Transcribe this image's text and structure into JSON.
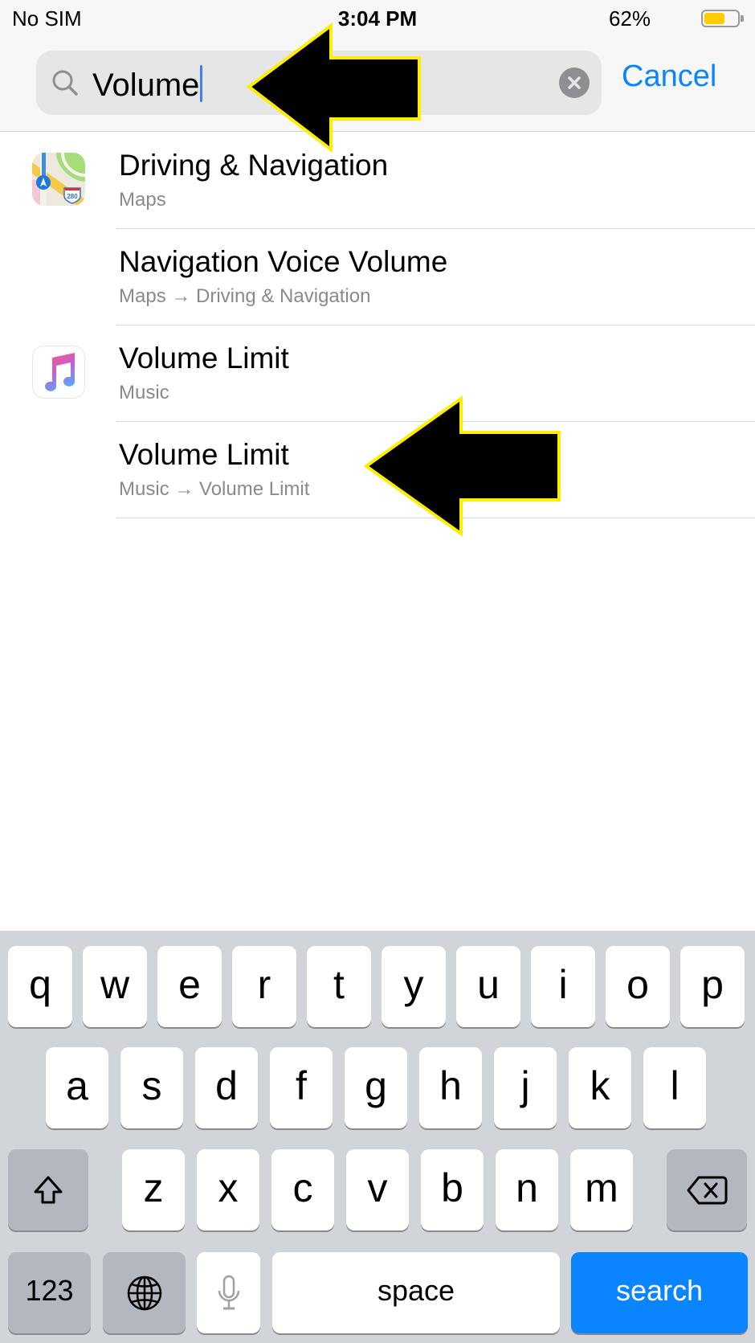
{
  "status_bar": {
    "carrier": "No SIM",
    "time": "3:04 PM",
    "battery_percent_label": "62%",
    "battery_level": 0.62,
    "battery_color": "#ffcc00"
  },
  "search": {
    "icon": "search-icon",
    "value": "Volume",
    "clear_icon": "clear-icon",
    "cancel_label": "Cancel",
    "accent_color": "#0a84ff"
  },
  "results": [
    {
      "title": "Driving & Navigation",
      "subtitle": "Maps",
      "icon": "maps-app-icon"
    },
    {
      "title": "Navigation Voice Volume",
      "subtitle": "Maps → Driving & Navigation",
      "icon": null
    },
    {
      "title": "Volume Limit",
      "subtitle": "Music",
      "icon": "music-app-icon"
    },
    {
      "title": "Volume Limit",
      "subtitle": "Music → Volume Limit",
      "icon": null
    }
  ],
  "annotations": [
    {
      "type": "arrow",
      "direction": "left",
      "points_to": "search-input",
      "fill": "#000000",
      "stroke": "#ffee00"
    },
    {
      "type": "arrow",
      "direction": "left",
      "points_to": "result-volume-limit-music-volume-limit",
      "fill": "#000000",
      "stroke": "#ffee00"
    }
  ],
  "keyboard": {
    "row1": [
      "q",
      "w",
      "e",
      "r",
      "t",
      "y",
      "u",
      "i",
      "o",
      "p"
    ],
    "row2": [
      "a",
      "s",
      "d",
      "f",
      "g",
      "h",
      "j",
      "k",
      "l"
    ],
    "row3": [
      "z",
      "x",
      "c",
      "v",
      "b",
      "n",
      "m"
    ],
    "shift_icon": "shift-icon",
    "delete_icon": "delete-icon",
    "numbers_label": "123",
    "globe_icon": "globe-icon",
    "mic_icon": "microphone-icon",
    "space_label": "space",
    "search_label": "search",
    "search_key_color": "#0a84ff"
  }
}
